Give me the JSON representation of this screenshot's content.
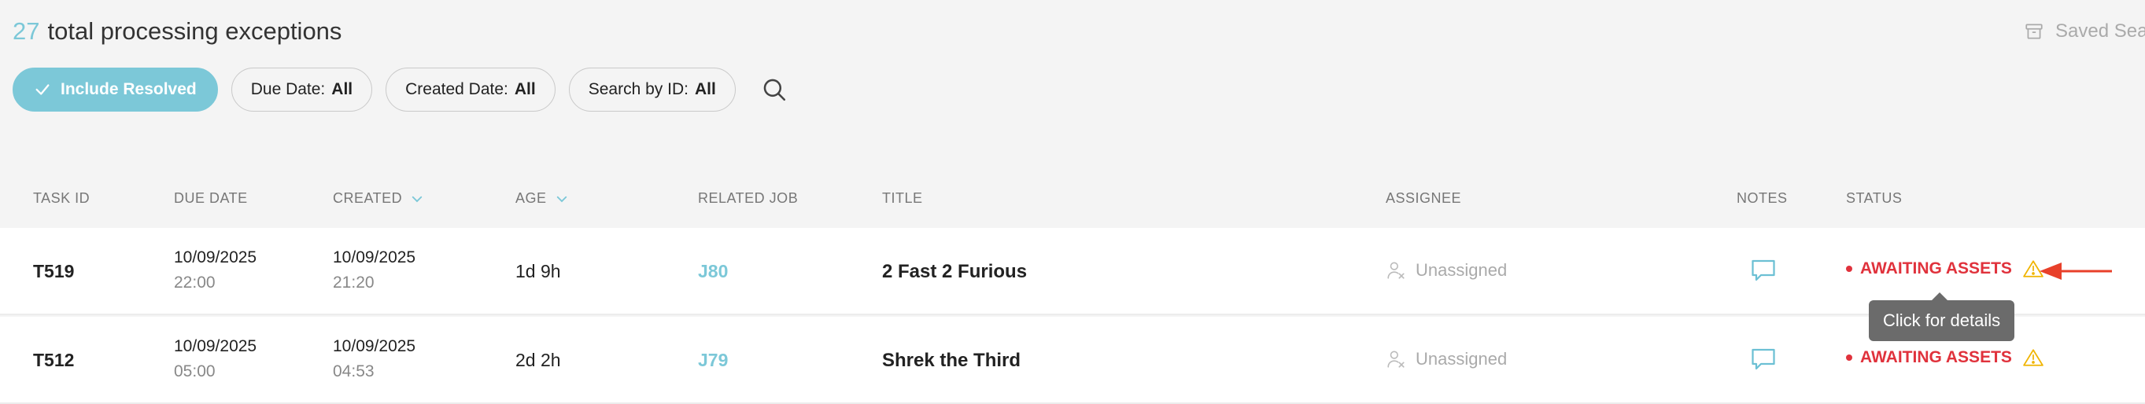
{
  "header": {
    "count": "27",
    "title": "total processing exceptions",
    "saved_search_label": "Saved Sear"
  },
  "filters": {
    "include_resolved": "Include Resolved",
    "due_date_label": "Due Date:",
    "due_date_value": "All",
    "created_date_label": "Created Date:",
    "created_date_value": "All",
    "search_by_id_label": "Search by ID:",
    "search_by_id_value": "All"
  },
  "table": {
    "columns": {
      "task_id": "TASK ID",
      "due_date": "DUE DATE",
      "created": "CREATED",
      "age": "AGE",
      "related_job": "RELATED JOB",
      "title": "TITLE",
      "assignee": "ASSIGNEE",
      "notes": "NOTES",
      "status": "STATUS"
    },
    "rows": [
      {
        "task_id": "T519",
        "due_date": "10/09/2025",
        "due_time": "22:00",
        "created_date": "10/09/2025",
        "created_time": "21:20",
        "age": "1d 9h",
        "related_job": "J80",
        "title": "2 Fast 2 Furious",
        "assignee": "Unassigned",
        "status": "AWAITING ASSETS"
      },
      {
        "task_id": "T512",
        "due_date": "10/09/2025",
        "due_time": "05:00",
        "created_date": "10/09/2025",
        "created_time": "04:53",
        "age": "2d 2h",
        "related_job": "J79",
        "title": "Shrek the Third",
        "assignee": "Unassigned",
        "status": "AWAITING ASSETS"
      }
    ]
  },
  "tooltip": "Click for details",
  "colors": {
    "accent": "#7cc8d8",
    "status_red": "#e0323c",
    "warning_yellow": "#f0b400",
    "arrow_red": "#e8402a",
    "tooltip_bg": "#6b6b6b"
  },
  "icons": {
    "saved_search": "archive-box-icon",
    "include_resolved": "checkmark-icon",
    "search": "search-icon",
    "sort": "chevron-down-icon",
    "assignee": "user-x-icon",
    "notes": "speech-bubble-icon",
    "warning": "warning-triangle-icon",
    "annotation": "left-arrow-icon"
  }
}
